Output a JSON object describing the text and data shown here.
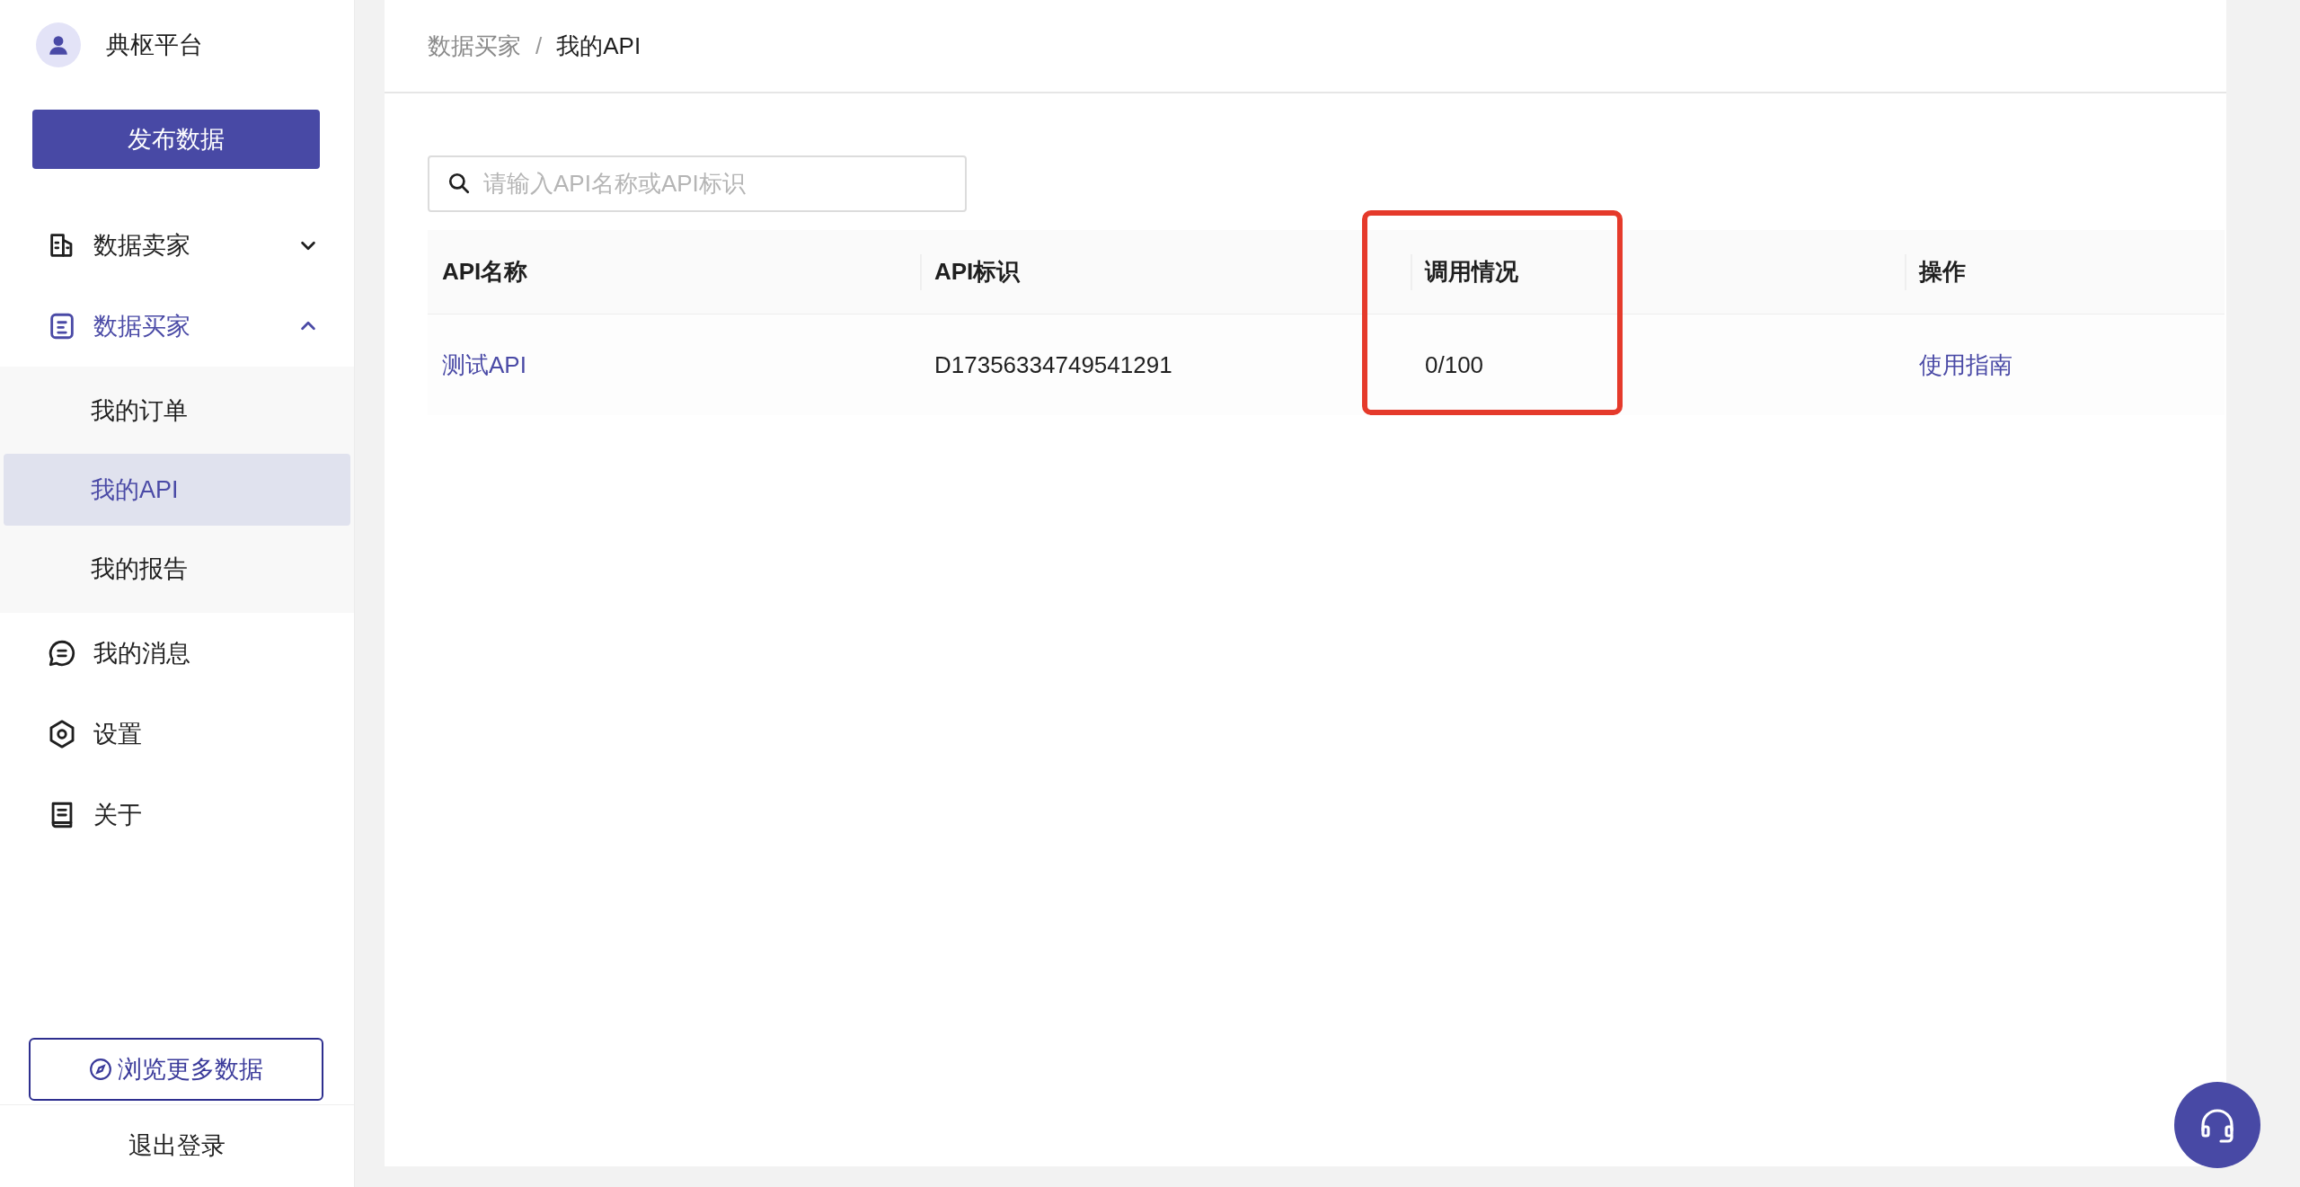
{
  "sidebar": {
    "brand": "典枢平台",
    "publish_button": "发布数据",
    "menu": [
      {
        "label": "数据卖家",
        "kind": "group",
        "selected": false,
        "expanded": false
      },
      {
        "label": "数据买家",
        "kind": "group",
        "selected": true,
        "expanded": true,
        "children": [
          {
            "label": "我的订单",
            "selected": false
          },
          {
            "label": "我的API",
            "selected": true
          },
          {
            "label": "我的报告",
            "selected": false
          }
        ]
      },
      {
        "label": "我的消息",
        "kind": "item",
        "selected": false
      },
      {
        "label": "设置",
        "kind": "item",
        "selected": false
      },
      {
        "label": "关于",
        "kind": "item",
        "selected": false
      }
    ],
    "browse_button": "浏览更多数据",
    "logout": "退出登录"
  },
  "breadcrumb": {
    "items": [
      "数据买家",
      "我的API"
    ],
    "separator": "/"
  },
  "search": {
    "placeholder": "请输入API名称或API标识"
  },
  "table": {
    "columns": [
      "API名称",
      "API标识",
      "调用情况",
      "操作"
    ],
    "rows": [
      {
        "cells": [
          "测试API",
          "D17356334749541291",
          "0/100",
          "使用指南"
        ]
      }
    ]
  }
}
